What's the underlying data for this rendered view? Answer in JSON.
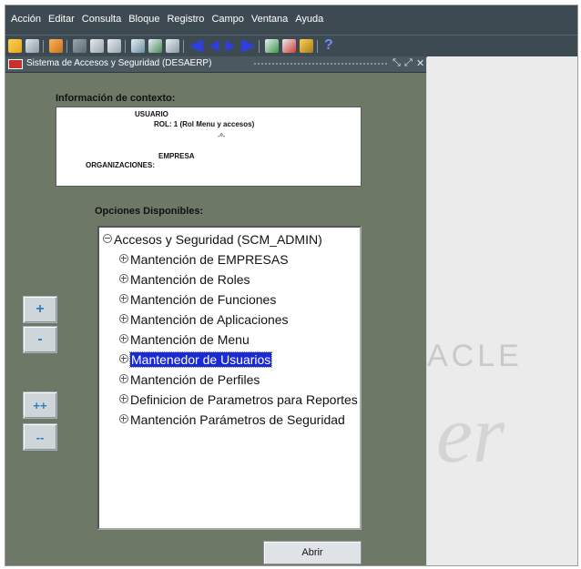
{
  "menu": [
    "Acción",
    "Editar",
    "Consulta",
    "Bloque",
    "Registro",
    "Campo",
    "Ventana",
    "Ayuda"
  ],
  "toolbar_icons": [
    "open-icon",
    "print-icon",
    "exit-icon",
    "cut-icon",
    "copy-icon",
    "paste-icon",
    "new-record-icon",
    "clear-icon",
    "duplicate-icon",
    "first-record-icon",
    "previous-record-icon",
    "next-record-icon",
    "last-record-icon",
    "insert-record-icon",
    "delete-record-icon",
    "lock-icon",
    "help-icon"
  ],
  "toolbar_help": "?",
  "window": {
    "title": "Sistema de Accesos y Seguridad (DESAERP)",
    "controls": [
      "⤡",
      "⤢",
      "✕"
    ]
  },
  "context": {
    "label": "Información de contexto:",
    "usuario": "USUARIO",
    "rol": "ROL: 1 (Rol Menu y accesos)",
    "separator": "-º-",
    "empresa": "EMPRESA",
    "organizaciones": "ORGANIZACIONES:"
  },
  "options": {
    "label": "Opciones Disponibles:",
    "root": "Accesos y Seguridad (SCM_ADMIN)",
    "items": [
      "Mantención de EMPRESAS",
      "Mantención de Roles",
      "Mantención de Funciones",
      "Mantención de Aplicaciones",
      "Mantención de Menu",
      "Mantenedor de Usuarios",
      "Mantención de Perfiles",
      "Definicion de Parametros para Reportes",
      "Mantención Parámetros de Seguridad"
    ],
    "selected_index": 5
  },
  "side_buttons": [
    "+",
    "-",
    "++",
    "--"
  ],
  "open_button": "Abrir",
  "background": {
    "oracle": "ACLE",
    "dev": "er"
  }
}
